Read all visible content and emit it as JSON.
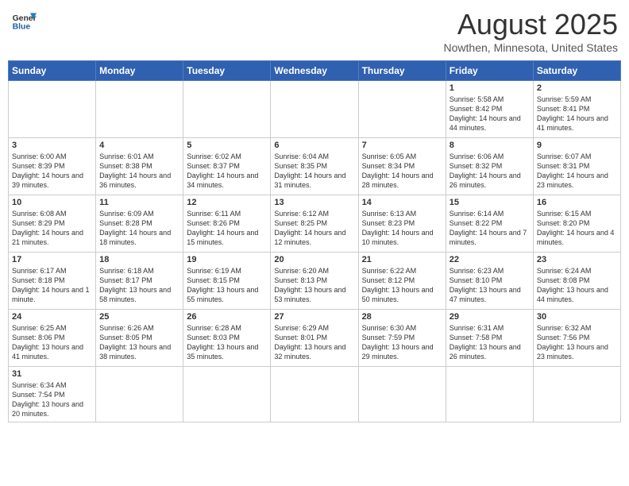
{
  "logo": {
    "text_general": "General",
    "text_blue": "Blue"
  },
  "title": "August 2025",
  "subtitle": "Nowthen, Minnesota, United States",
  "days": [
    "Sunday",
    "Monday",
    "Tuesday",
    "Wednesday",
    "Thursday",
    "Friday",
    "Saturday"
  ],
  "weeks": [
    [
      {
        "date": "",
        "info": ""
      },
      {
        "date": "",
        "info": ""
      },
      {
        "date": "",
        "info": ""
      },
      {
        "date": "",
        "info": ""
      },
      {
        "date": "",
        "info": ""
      },
      {
        "date": "1",
        "info": "Sunrise: 5:58 AM\nSunset: 8:42 PM\nDaylight: 14 hours and 44 minutes."
      },
      {
        "date": "2",
        "info": "Sunrise: 5:59 AM\nSunset: 8:41 PM\nDaylight: 14 hours and 41 minutes."
      }
    ],
    [
      {
        "date": "3",
        "info": "Sunrise: 6:00 AM\nSunset: 8:39 PM\nDaylight: 14 hours and 39 minutes."
      },
      {
        "date": "4",
        "info": "Sunrise: 6:01 AM\nSunset: 8:38 PM\nDaylight: 14 hours and 36 minutes."
      },
      {
        "date": "5",
        "info": "Sunrise: 6:02 AM\nSunset: 8:37 PM\nDaylight: 14 hours and 34 minutes."
      },
      {
        "date": "6",
        "info": "Sunrise: 6:04 AM\nSunset: 8:35 PM\nDaylight: 14 hours and 31 minutes."
      },
      {
        "date": "7",
        "info": "Sunrise: 6:05 AM\nSunset: 8:34 PM\nDaylight: 14 hours and 28 minutes."
      },
      {
        "date": "8",
        "info": "Sunrise: 6:06 AM\nSunset: 8:32 PM\nDaylight: 14 hours and 26 minutes."
      },
      {
        "date": "9",
        "info": "Sunrise: 6:07 AM\nSunset: 8:31 PM\nDaylight: 14 hours and 23 minutes."
      }
    ],
    [
      {
        "date": "10",
        "info": "Sunrise: 6:08 AM\nSunset: 8:29 PM\nDaylight: 14 hours and 21 minutes."
      },
      {
        "date": "11",
        "info": "Sunrise: 6:09 AM\nSunset: 8:28 PM\nDaylight: 14 hours and 18 minutes."
      },
      {
        "date": "12",
        "info": "Sunrise: 6:11 AM\nSunset: 8:26 PM\nDaylight: 14 hours and 15 minutes."
      },
      {
        "date": "13",
        "info": "Sunrise: 6:12 AM\nSunset: 8:25 PM\nDaylight: 14 hours and 12 minutes."
      },
      {
        "date": "14",
        "info": "Sunrise: 6:13 AM\nSunset: 8:23 PM\nDaylight: 14 hours and 10 minutes."
      },
      {
        "date": "15",
        "info": "Sunrise: 6:14 AM\nSunset: 8:22 PM\nDaylight: 14 hours and 7 minutes."
      },
      {
        "date": "16",
        "info": "Sunrise: 6:15 AM\nSunset: 8:20 PM\nDaylight: 14 hours and 4 minutes."
      }
    ],
    [
      {
        "date": "17",
        "info": "Sunrise: 6:17 AM\nSunset: 8:18 PM\nDaylight: 14 hours and 1 minute."
      },
      {
        "date": "18",
        "info": "Sunrise: 6:18 AM\nSunset: 8:17 PM\nDaylight: 13 hours and 58 minutes."
      },
      {
        "date": "19",
        "info": "Sunrise: 6:19 AM\nSunset: 8:15 PM\nDaylight: 13 hours and 55 minutes."
      },
      {
        "date": "20",
        "info": "Sunrise: 6:20 AM\nSunset: 8:13 PM\nDaylight: 13 hours and 53 minutes."
      },
      {
        "date": "21",
        "info": "Sunrise: 6:22 AM\nSunset: 8:12 PM\nDaylight: 13 hours and 50 minutes."
      },
      {
        "date": "22",
        "info": "Sunrise: 6:23 AM\nSunset: 8:10 PM\nDaylight: 13 hours and 47 minutes."
      },
      {
        "date": "23",
        "info": "Sunrise: 6:24 AM\nSunset: 8:08 PM\nDaylight: 13 hours and 44 minutes."
      }
    ],
    [
      {
        "date": "24",
        "info": "Sunrise: 6:25 AM\nSunset: 8:06 PM\nDaylight: 13 hours and 41 minutes."
      },
      {
        "date": "25",
        "info": "Sunrise: 6:26 AM\nSunset: 8:05 PM\nDaylight: 13 hours and 38 minutes."
      },
      {
        "date": "26",
        "info": "Sunrise: 6:28 AM\nSunset: 8:03 PM\nDaylight: 13 hours and 35 minutes."
      },
      {
        "date": "27",
        "info": "Sunrise: 6:29 AM\nSunset: 8:01 PM\nDaylight: 13 hours and 32 minutes."
      },
      {
        "date": "28",
        "info": "Sunrise: 6:30 AM\nSunset: 7:59 PM\nDaylight: 13 hours and 29 minutes."
      },
      {
        "date": "29",
        "info": "Sunrise: 6:31 AM\nSunset: 7:58 PM\nDaylight: 13 hours and 26 minutes."
      },
      {
        "date": "30",
        "info": "Sunrise: 6:32 AM\nSunset: 7:56 PM\nDaylight: 13 hours and 23 minutes."
      }
    ],
    [
      {
        "date": "31",
        "info": "Sunrise: 6:34 AM\nSunset: 7:54 PM\nDaylight: 13 hours and 20 minutes."
      },
      {
        "date": "",
        "info": ""
      },
      {
        "date": "",
        "info": ""
      },
      {
        "date": "",
        "info": ""
      },
      {
        "date": "",
        "info": ""
      },
      {
        "date": "",
        "info": ""
      },
      {
        "date": "",
        "info": ""
      }
    ]
  ]
}
